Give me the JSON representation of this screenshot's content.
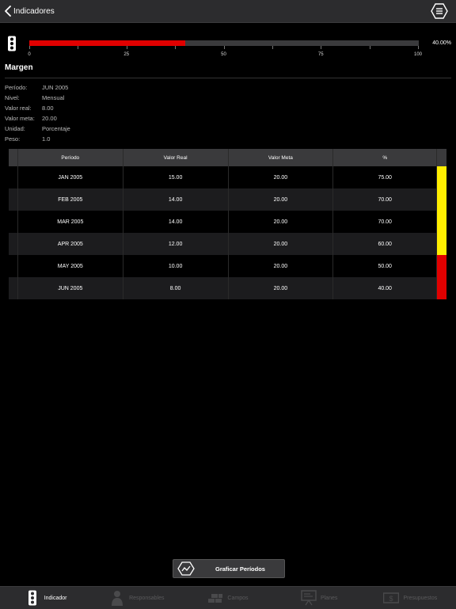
{
  "header": {
    "back_label": "Indicadores"
  },
  "progress": {
    "value_percent": 40,
    "label": "40.00%",
    "ticks": [
      "0",
      "25",
      "50",
      "75",
      "100"
    ],
    "fill_color": "#e00000"
  },
  "section": {
    "title": "Margen"
  },
  "details": [
    {
      "label": "Período:",
      "value": "JUN 2005"
    },
    {
      "label": "Nivel:",
      "value": "Mensual"
    },
    {
      "label": "Valor real:",
      "value": "8.00"
    },
    {
      "label": "Valor meta:",
      "value": "20.00"
    },
    {
      "label": "Unidad:",
      "value": "Porcentaje"
    },
    {
      "label": "Peso:",
      "value": "1.0"
    }
  ],
  "table": {
    "headers": {
      "period": "Período",
      "real": "Valor Real",
      "meta": "Valor Meta",
      "pct": "%"
    },
    "rows": [
      {
        "period": "JAN 2005",
        "real": "15.00",
        "meta": "20.00",
        "pct": "75.00",
        "status_color": "#ffee00"
      },
      {
        "period": "FEB 2005",
        "real": "14.00",
        "meta": "20.00",
        "pct": "70.00",
        "status_color": "#ffee00"
      },
      {
        "period": "MAR 2005",
        "real": "14.00",
        "meta": "20.00",
        "pct": "70.00",
        "status_color": "#ffee00"
      },
      {
        "period": "APR 2005",
        "real": "12.00",
        "meta": "20.00",
        "pct": "60.00",
        "status_color": "#ffee00"
      },
      {
        "period": "MAY 2005",
        "real": "10.00",
        "meta": "20.00",
        "pct": "50.00",
        "status_color": "#e00000"
      },
      {
        "period": "JUN 2005",
        "real": "8.00",
        "meta": "20.00",
        "pct": "40.00",
        "status_color": "#e00000"
      }
    ]
  },
  "chart_button": {
    "label": "Graficar Períodos",
    "icon": "chart-icon"
  },
  "tabbar": {
    "tabs": [
      {
        "label": "Indicador",
        "icon": "traffic-light-icon",
        "active": true
      },
      {
        "label": "Responsables",
        "icon": "person-icon",
        "active": false
      },
      {
        "label": "Campos",
        "icon": "bricks-icon",
        "active": false
      },
      {
        "label": "Planes",
        "icon": "presentation-board-icon",
        "active": false
      },
      {
        "label": "Presupuestos",
        "icon": "money-icon",
        "active": false
      }
    ]
  },
  "colors": {
    "accent_red": "#e00000",
    "warning_yellow": "#ffee00",
    "bar_background": "#2c2c2e"
  }
}
